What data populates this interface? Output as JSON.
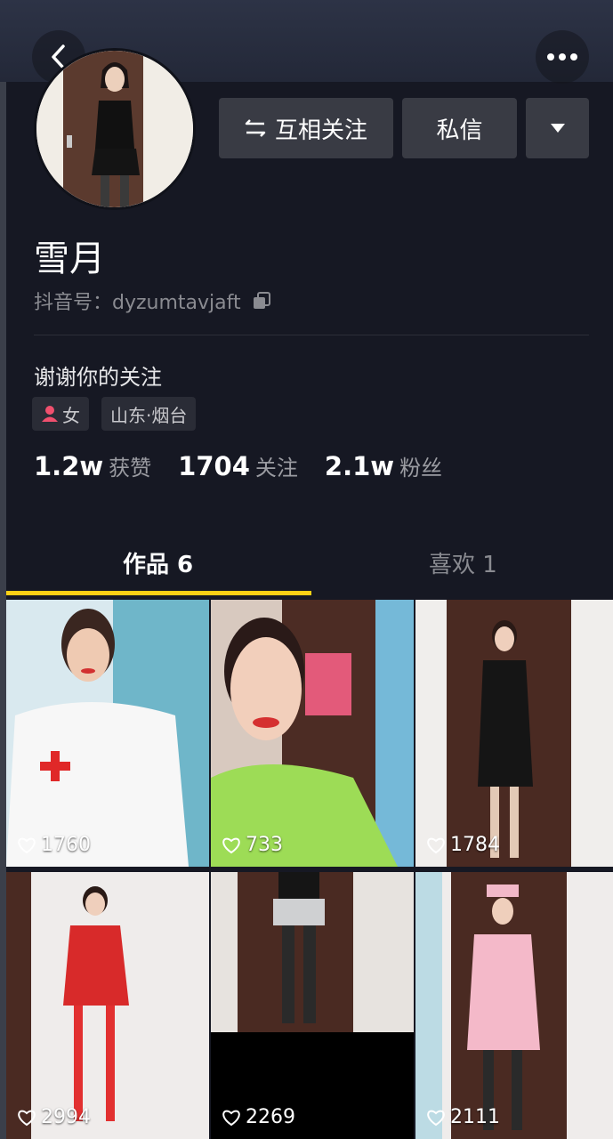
{
  "header": {
    "back_icon": "chevron-left-icon",
    "more_icon": "more-dots-icon"
  },
  "actions": {
    "follow_label": "互相关注",
    "message_label": "私信",
    "dropdown_icon": "caret-down-icon"
  },
  "profile": {
    "name": "雪月",
    "douyin_id": "抖音号：dyzumtavjaft",
    "bio": "谢谢你的关注",
    "gender": "女",
    "location": "山东·烟台"
  },
  "stats": {
    "likes_value": "1.2w",
    "likes_label": "获赞",
    "following_value": "1704",
    "following_label": "关注",
    "followers_value": "2.1w",
    "followers_label": "粉丝"
  },
  "tabs": {
    "works": "作品 6",
    "liked": "喜欢 1"
  },
  "videos": [
    {
      "likes": "1760"
    },
    {
      "likes": "733"
    },
    {
      "likes": "1784"
    },
    {
      "likes": "2994"
    },
    {
      "likes": "2269"
    },
    {
      "likes": "2111"
    }
  ],
  "colors": {
    "background": "#161823",
    "accent": "#fcd015",
    "button": "#393b44"
  }
}
